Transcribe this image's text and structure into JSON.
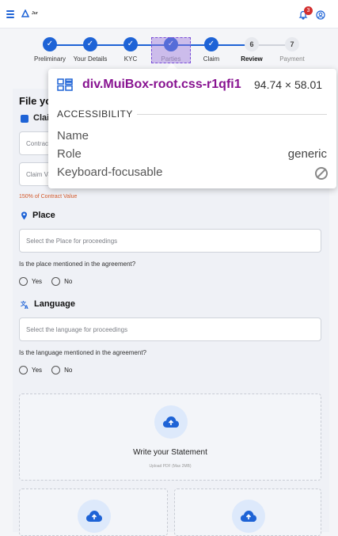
{
  "header": {
    "logo_text": "Jur",
    "notification_count": "3"
  },
  "stepper": {
    "steps": [
      {
        "label": "Preliminary",
        "state": "done"
      },
      {
        "label": "Your Details",
        "state": "done"
      },
      {
        "label": "KYC",
        "state": "done"
      },
      {
        "label": "Parties",
        "state": "done"
      },
      {
        "label": "Claim",
        "state": "done"
      },
      {
        "label": "Review",
        "state": "current",
        "number": "6"
      },
      {
        "label": "Payment",
        "state": "pending",
        "number": "7"
      }
    ]
  },
  "form": {
    "title": "File yo",
    "claim_label": "Clai",
    "contract_placeholder": "Contrac",
    "claim_value_placeholder": "Claim Va",
    "claim_helper": "150% of Contract Value",
    "place": {
      "heading": "Place",
      "placeholder": "Select the Place for proceedings",
      "question": "Is the place mentioned in the agreement?",
      "yes": "Yes",
      "no": "No"
    },
    "language": {
      "heading": "Language",
      "placeholder": "Select the language for proceedings",
      "question": "Is the language mentioned in the agreement?",
      "yes": "Yes",
      "no": "No"
    },
    "statement": {
      "title": "Write your Statement",
      "subtitle": "Upload PDF (Max 2MB)"
    }
  },
  "inspector": {
    "selector": "div.MuiBox-root.css-r1qfi1",
    "dimensions": "94.74 × 58.01",
    "section": "ACCESSIBILITY",
    "rows": [
      {
        "label": "Name",
        "value": ""
      },
      {
        "label": "Role",
        "value": "generic"
      },
      {
        "label": "Keyboard-focusable",
        "value": ""
      }
    ]
  },
  "colors": {
    "primary": "#1e63d6",
    "selector": "#881391",
    "helper": "#d35a2c"
  }
}
